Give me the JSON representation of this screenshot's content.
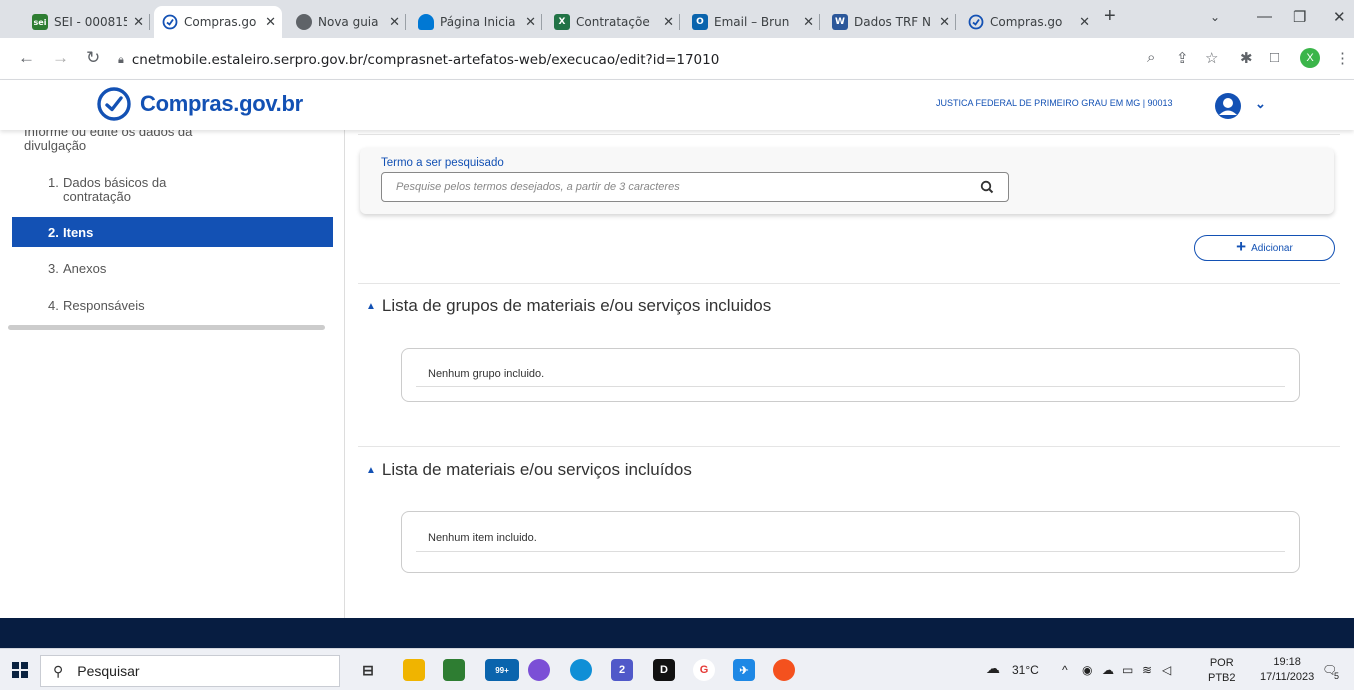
{
  "browser": {
    "tabs": [
      {
        "label": "SEI - 000815",
        "fav_text": "sei",
        "fav_color": "#2e7d32"
      },
      {
        "label": "Compras.go",
        "fav_text": "",
        "fav_color": "#1351b4"
      },
      {
        "label": "Nova guia",
        "fav_text": "",
        "fav_color": "#5f6368"
      },
      {
        "label": "Página Inicia",
        "fav_text": "",
        "fav_color": "#0078d4"
      },
      {
        "label": "Contrataçõe",
        "fav_text": "X",
        "fav_color": "#217346"
      },
      {
        "label": "Email – Brun",
        "fav_text": "O",
        "fav_color": "#0a64ad"
      },
      {
        "label": "Dados TRF N",
        "fav_text": "W",
        "fav_color": "#2b579a"
      },
      {
        "label": "Compras.go",
        "fav_text": "",
        "fav_color": "#1351b4"
      }
    ],
    "url": "cnetmobile.estaleiro.serpro.gov.br/comprasnet-artefatos-web/execucao/edit?id=17010",
    "profile_initial": "X"
  },
  "header": {
    "logo_text": "Compras.gov.br",
    "org_text": "JUSTICA FEDERAL DE PRIMEIRO GRAU EM MG | 90013"
  },
  "sidebar": {
    "cut_text": "Informe ou edite os dados da",
    "section_label": "divulgação",
    "items": [
      {
        "num": "1.",
        "label": "Dados básicos da contratação"
      },
      {
        "num": "2.",
        "label": "Itens"
      },
      {
        "num": "3.",
        "label": "Anexos"
      },
      {
        "num": "4.",
        "label": "Responsáveis"
      }
    ]
  },
  "main": {
    "search_label": "Termo a ser pesquisado",
    "search_placeholder": "Pesquise pelos termos desejados, a partir de 3 caracteres",
    "add_button": "Adicionar",
    "groups_title": "Lista de grupos de materiais e/ou serviços incluidos",
    "groups_empty": "Nenhum grupo incluido.",
    "items_title": "Lista de materiais e/ou serviços incluídos",
    "items_empty": "Nenhum item incluido."
  },
  "taskbar": {
    "search_text": "Pesquisar",
    "badge_mail": "99+",
    "badge_teams": "2",
    "weather": "31°C",
    "lang_top": "POR",
    "lang_bottom": "PTB2",
    "time": "19:18",
    "date": "17/11/2023",
    "notif_count": "5"
  },
  "colors": {
    "brand": "#1351b4",
    "footer": "#071d41"
  }
}
